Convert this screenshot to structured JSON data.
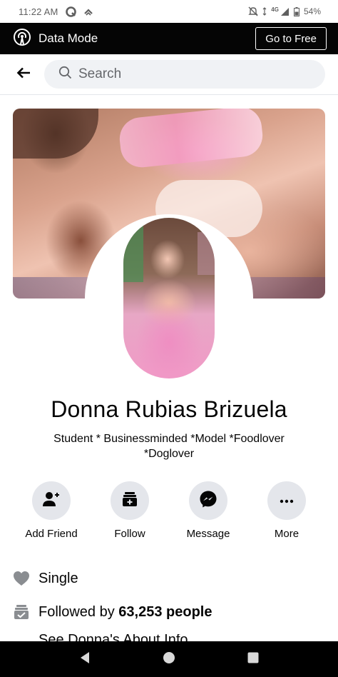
{
  "status_bar": {
    "time": "11:22 AM",
    "network": "4G",
    "battery": "54%"
  },
  "data_mode_bar": {
    "label": "Data Mode",
    "go_free_label": "Go to Free"
  },
  "search": {
    "placeholder": "Search"
  },
  "profile": {
    "name": "Donna Rubias Brizuela",
    "bio_line1": "Student * Businessminded *Model *Foodlover",
    "bio_line2": "*Doglover"
  },
  "actions": [
    {
      "label": "Add Friend",
      "icon": "add-friend-icon"
    },
    {
      "label": "Follow",
      "icon": "follow-icon"
    },
    {
      "label": "Message",
      "icon": "messenger-icon"
    },
    {
      "label": "More",
      "icon": "more-icon"
    }
  ],
  "info": {
    "relationship": "Single",
    "followed_prefix": "Followed by",
    "followed_count": "63,253 people",
    "about_partial": "See Donna's About Info"
  },
  "colors": {
    "accent_bar": "#050505",
    "button_bg": "#e4e6eb",
    "search_bg": "#f0f2f5",
    "icon_gray": "#65676b"
  }
}
